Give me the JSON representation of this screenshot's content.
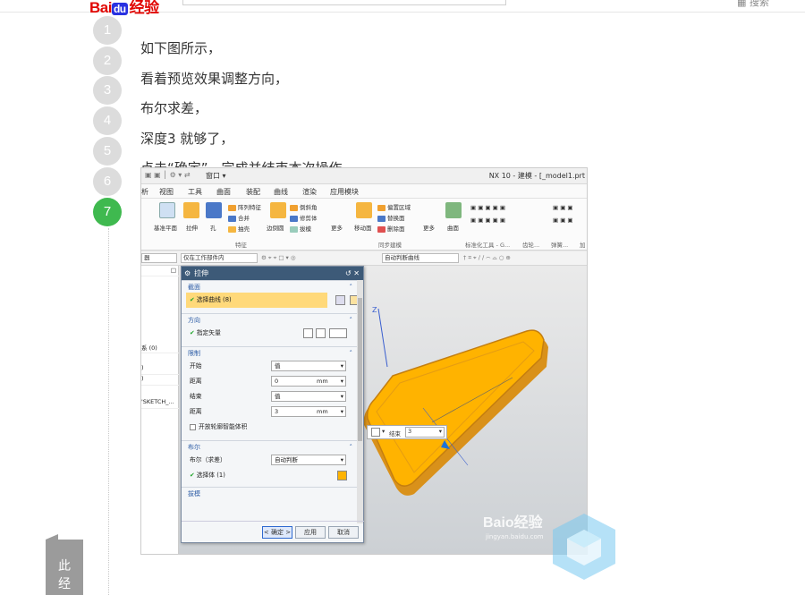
{
  "header": {
    "logo_bai": "Bai",
    "logo_du": "du",
    "logo_jy": "经验",
    "search_icon": "search-icon",
    "right_link": "搜索"
  },
  "steps": [
    "1",
    "2",
    "3",
    "4",
    "5",
    "6",
    "7"
  ],
  "active_step": "7",
  "instructions": [
    "如下图所示，",
    "看着预览效果调整方向，",
    "布尔求差，",
    "深度3 就够了，",
    "点击“确定”，完成并结束本次操作。"
  ],
  "side_tab": "此经",
  "screenshot": {
    "window_title": "NX 10 - 建模 - [_model1.prt",
    "window_menu": "窗口 ▾",
    "menus": [
      "析",
      "视图",
      "工具",
      "曲面",
      "装配",
      "曲线",
      "渲染",
      "应用模块"
    ],
    "ribbon": {
      "datum": "基准平面",
      "extrude": "拉伸",
      "hole": "孔",
      "array": "阵列特征",
      "unite": "合并",
      "shell": "抽壳",
      "edge_blend": "边倒圆",
      "chamfer": "倒斜角",
      "trim_body": "修剪体",
      "draft": "拔模",
      "more": "更多",
      "move_face": "移动面",
      "offset_region": "偏置区域",
      "replace_face": "替换面",
      "delete_face": "删除面",
      "more2": "更多",
      "surface": "曲面",
      "group_feature": "特征",
      "group_sync": "同步建模",
      "group_std": "标准化工具 - G...",
      "group_gear": "齿轮...",
      "group_spring": "弹簧...",
      "group_add": "加"
    },
    "filter": {
      "select_left": "器",
      "scope": "仅在工作部件内",
      "curve_rule": "自动判断曲线"
    },
    "nav_items": [
      "系 (0)",
      ")",
      ")",
      "'SKETCH_..."
    ],
    "dialog": {
      "title": "拉伸",
      "section_profile": "截面",
      "select_curve": "选择曲线 (8)",
      "section_direction": "方向",
      "specify_vector": "指定矢量",
      "section_limits": "限制",
      "start_label": "开始",
      "start_value": "值",
      "distance1_label": "距离",
      "distance1_value": "0",
      "distance1_unit": "mm",
      "end_label": "结束",
      "end_value": "值",
      "distance2_label": "距离",
      "distance2_value": "3",
      "distance2_unit": "mm",
      "open_profile": "开放轮廓智能体积",
      "section_boolean": "布尔",
      "boolean_label": "布尔（求差）",
      "boolean_value": "自动判断",
      "select_body": "选择体 (1)",
      "section_draft": "拔模",
      "ok": "< 确定 >",
      "apply": "应用",
      "cancel": "取消"
    },
    "endbox": {
      "label": "结束",
      "value": "3"
    }
  },
  "watermark": {
    "text": "Baio经验",
    "url": "jingyan.baidu.com"
  }
}
